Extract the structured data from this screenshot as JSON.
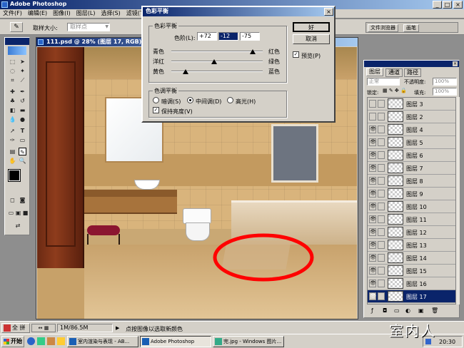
{
  "app": {
    "title": "Adobe Photoshop"
  },
  "menu": [
    "文件(F)",
    "编辑(E)",
    "图像(I)",
    "图层(L)",
    "选择(S)",
    "滤镜(T)"
  ],
  "options": {
    "sample_label": "取样大小:",
    "sample_value": "取样点"
  },
  "palette_tabs": [
    "文件浏览器",
    "画笔"
  ],
  "doc": {
    "title": "111.psd @ 28% (图层 17, RGB)",
    "status_size": "1M/86.5M",
    "status_zoom": "全 拼",
    "status_hint": "点按图像以选取新颜色"
  },
  "dialog": {
    "title": "色彩平衡",
    "group_balance": "色彩平衡",
    "levels_label": "色阶(L):",
    "levels": [
      "+72",
      "-12",
      "-75"
    ],
    "sliders": [
      {
        "left": "青色",
        "right": "红色",
        "value": 72
      },
      {
        "left": "洋红",
        "right": "绿色",
        "value": -12
      },
      {
        "left": "黄色",
        "right": "蓝色",
        "value": -75
      }
    ],
    "group_tone": "色调平衡",
    "tones": [
      "暗调(S)",
      "中间调(D)",
      "高光(H)"
    ],
    "selected_tone": "中间调(D)",
    "preserve": "保持亮度(V)",
    "ok": "好",
    "cancel": "取消",
    "preview": "预览(P)"
  },
  "layers": {
    "tabs": [
      "图层",
      "通道",
      "路径"
    ],
    "mode": "正常",
    "opacity_label": "不透明度:",
    "opacity": "100%",
    "lock_label": "锁定:",
    "fill_label": "填充:",
    "fill": "100%",
    "items": [
      {
        "name": "图层 3",
        "visible": false
      },
      {
        "name": "图层 2",
        "visible": false
      },
      {
        "name": "图层 4",
        "visible": true
      },
      {
        "name": "图层 5",
        "visible": true
      },
      {
        "name": "图层 6",
        "visible": true
      },
      {
        "name": "图层 7",
        "visible": true
      },
      {
        "name": "图层 8",
        "visible": true
      },
      {
        "name": "图层 9",
        "visible": true
      },
      {
        "name": "图层 10",
        "visible": true
      },
      {
        "name": "图层 11",
        "visible": true
      },
      {
        "name": "图层 12",
        "visible": true
      },
      {
        "name": "图层 13",
        "visible": true
      },
      {
        "name": "图层 14",
        "visible": true
      },
      {
        "name": "图层 15",
        "visible": true
      },
      {
        "name": "图层 16",
        "visible": true
      },
      {
        "name": "图层 17",
        "visible": true,
        "selected": true
      }
    ]
  },
  "taskbar": {
    "start": "开始",
    "tasks": [
      "室内渲染与表现 - AB...",
      "Adobe Photoshop",
      "完.jpg - Windows 图片..."
    ],
    "clock": "20:30",
    "watermark": "室内人"
  },
  "colors": {
    "titlebar": "#0a246a",
    "desktop": "#8e8e8e",
    "accent_red": "#ff0000"
  }
}
